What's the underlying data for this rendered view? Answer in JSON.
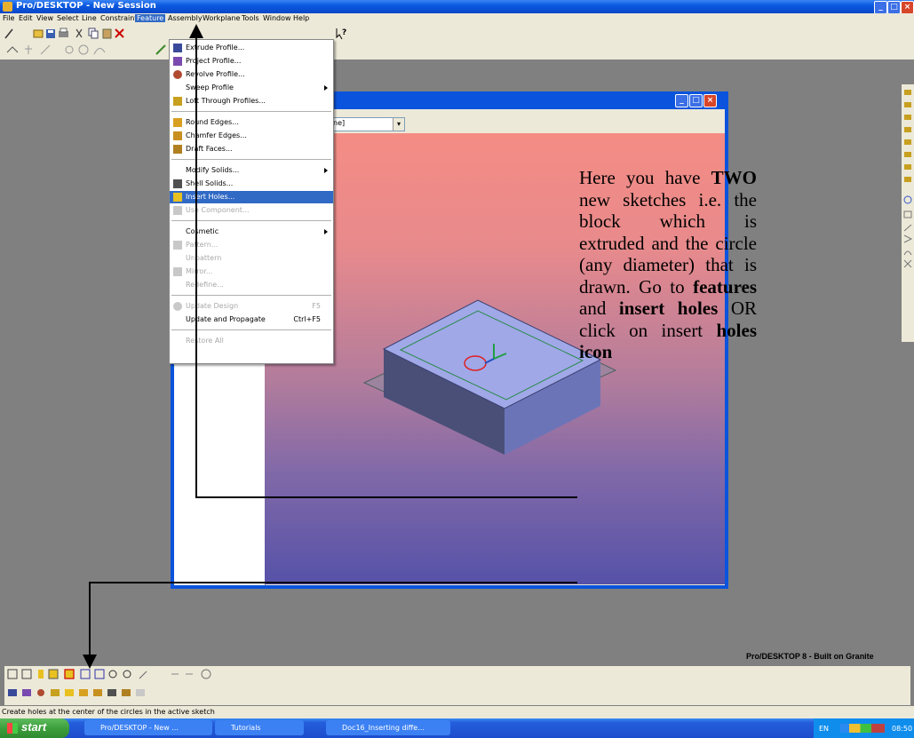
{
  "window": {
    "title": "Pro/DESKTOP - New Session",
    "buttons": [
      "_",
      "□",
      "×"
    ]
  },
  "menubar": [
    "File",
    "Edit",
    "View",
    "Select",
    "Line",
    "Constraint",
    "Feature",
    "Assembly",
    "Workplane",
    "Tools",
    "Window",
    "Help"
  ],
  "feature_menu": {
    "items": [
      {
        "label": "Extrude Profile...",
        "state": "normal"
      },
      {
        "label": "Project Profile...",
        "state": "normal"
      },
      {
        "label": "Revolve Profile...",
        "state": "normal"
      },
      {
        "label": "Sweep Profile",
        "state": "normal",
        "submenu": true
      },
      {
        "label": "Loft Through Profiles...",
        "state": "normal"
      },
      {
        "label": "Round Edges...",
        "state": "normal"
      },
      {
        "label": "Chamfer Edges...",
        "state": "normal"
      },
      {
        "label": "Draft Faces...",
        "state": "normal"
      },
      {
        "label": "Modify Solids...",
        "state": "normal",
        "submenu": true
      },
      {
        "label": "Shell Solids...",
        "state": "normal"
      },
      {
        "label": "Insert Holes...",
        "state": "highlighted"
      },
      {
        "label": "Use Component...",
        "state": "disabled"
      },
      {
        "label": "Cosmetic",
        "state": "normal",
        "submenu": true
      },
      {
        "label": "Pattern...",
        "state": "disabled"
      },
      {
        "label": "Unpattern",
        "state": "disabled"
      },
      {
        "label": "Mirror...",
        "state": "disabled"
      },
      {
        "label": "Redefine...",
        "state": "disabled"
      },
      {
        "label": "Update Design",
        "state": "disabled",
        "shortcut": "F5"
      },
      {
        "label": "Update and Propagate",
        "state": "normal",
        "shortcut": "Ctrl+F5"
      },
      {
        "label": "Restore All",
        "state": "disabled"
      }
    ]
  },
  "sketch_window": {
    "combo_value": "ne]",
    "buttons": [
      "_",
      "□",
      "×"
    ]
  },
  "annotation": {
    "t1": "Here you have",
    "t2": "TWO",
    "t3": "new sketches i.e. the block which is extruded and the circle (any diameter) that is drawn. Go to",
    "t4": "features",
    "t5": "and",
    "t6": "insert holes",
    "t7": "OR click on insert",
    "t8": "holes icon"
  },
  "brand": "Pro/DESKTOP 8 - Built on Granite",
  "status": "Create holes at the center of the circles in the active sketch",
  "taskbar": {
    "start": "start",
    "tasks": [
      "Pro/DESKTOP - New ...",
      "Tutorials",
      "Doc16_Inserting diffe..."
    ],
    "tray": {
      "lang": "EN",
      "time": "08:50"
    }
  },
  "colors": {
    "titlebar": "#0a5ae0",
    "menu_highlight": "#316ac5",
    "viewport_top": "#f48c84",
    "viewport_bottom": "#5652a8",
    "taskbar": "#245edc",
    "start": "#3c9f3c"
  }
}
